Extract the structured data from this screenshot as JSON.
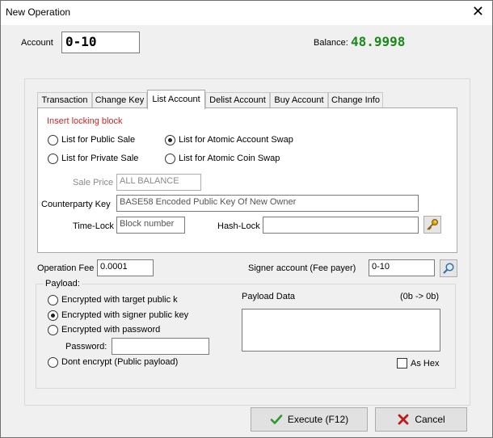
{
  "window": {
    "title": "New Operation",
    "close_glyph": "✕"
  },
  "account": {
    "label": "Account",
    "value": "0-10"
  },
  "balance": {
    "label": "Balance:",
    "value": "48.9998",
    "color": "#1a8a1a"
  },
  "tabs": [
    {
      "label": "Transaction",
      "active": false
    },
    {
      "label": "Change Key",
      "active": false
    },
    {
      "label": "List Account",
      "active": true
    },
    {
      "label": "Delist Account",
      "active": false
    },
    {
      "label": "Buy Account",
      "active": false
    },
    {
      "label": "Change Info",
      "active": false
    }
  ],
  "list_account": {
    "section_title": "Insert locking block",
    "section_title_color": "#e02020",
    "radios": {
      "public_sale": {
        "label": "List for Public Sale",
        "selected": false
      },
      "private_sale": {
        "label": "List for Private Sale",
        "selected": false
      },
      "atomic_account_swap": {
        "label": "List for Atomic Account Swap",
        "selected": true
      },
      "atomic_coin_swap": {
        "label": "List for Atomic Coin Swap",
        "selected": false
      }
    },
    "sale_price": {
      "label": "Sale Price",
      "value": "ALL BALANCE"
    },
    "counterparty_key": {
      "label": "Counterparty Key",
      "value": "BASE58 Encoded Public Key Of New Owner"
    },
    "time_lock": {
      "label": "Time-Lock",
      "value": "Block number"
    },
    "hash_lock": {
      "label": "Hash-Lock",
      "value": "",
      "icon": "key-icon"
    }
  },
  "fee": {
    "label": "Operation Fee",
    "value": "0.0001"
  },
  "signer": {
    "label": "Signer account (Fee payer)",
    "value": "0-10",
    "icon": "search-icon"
  },
  "payload": {
    "group_label": "Payload:",
    "options": {
      "target_key": {
        "label": "Encrypted with target public k",
        "selected": false
      },
      "signer_key": {
        "label": "Encrypted with signer public key",
        "selected": true
      },
      "password": {
        "label": "Encrypted with password",
        "selected": false
      },
      "none": {
        "label": "Dont encrypt (Public payload)",
        "selected": false
      }
    },
    "password_label": "Password:",
    "password_value": "",
    "data_label": "Payload Data",
    "size_label": "(0b -> 0b)",
    "data_value": "",
    "as_hex_label": "As Hex",
    "as_hex_checked": false
  },
  "buttons": {
    "execute": {
      "label": "Execute (F12)",
      "icon": "checkmark-icon",
      "color": "#2e9a2e"
    },
    "cancel": {
      "label": "Cancel",
      "icon": "cross-icon",
      "color": "#c01818"
    }
  }
}
